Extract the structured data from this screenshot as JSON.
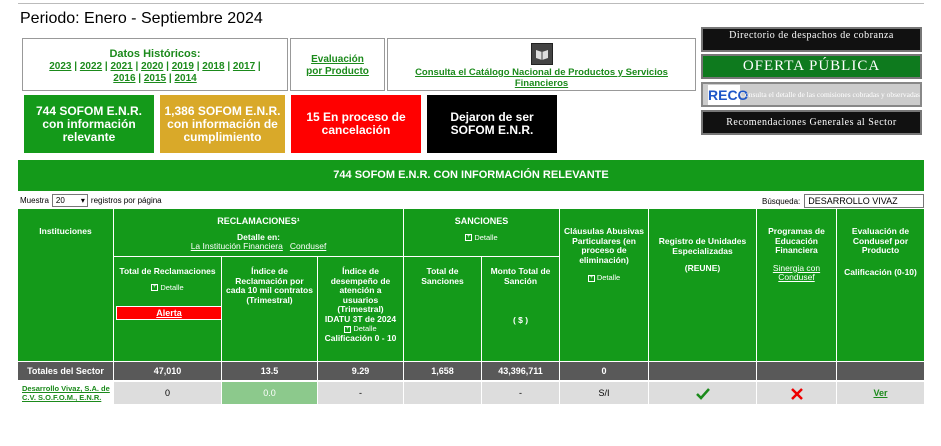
{
  "header": {
    "periodo": "Periodo: Enero - Septiembre 2024"
  },
  "historicos": {
    "title": "Datos Históricos:",
    "years": [
      "2023",
      "2022",
      "2021",
      "2020",
      "2019",
      "2018",
      "2017",
      "2016",
      "2015",
      "2014"
    ]
  },
  "evaluacion": {
    "line1": "Evaluación",
    "line2": "por Producto"
  },
  "catalogo": {
    "label": "Consulta el Catálogo Nacional de Productos y Servicios Financieros"
  },
  "right_links": {
    "directorio": "Directorio de despachos de cobranza",
    "oferta": "OFERTA PÚBLICA",
    "reco_logo": "RECO",
    "reco_text": "Consulta el detalle de las comisiones cobradas y observadas",
    "recomendaciones": "Recomendaciones Generales al Sector"
  },
  "kpis": [
    {
      "label": "744 SOFOM E.N.R. con información relevante",
      "color": "#149a1a"
    },
    {
      "label": "1,386 SOFOM E.N.R. con información de cumplimiento",
      "color": "#d9a929"
    },
    {
      "label": "15 En proceso de cancelación",
      "color": "#ff0000"
    },
    {
      "label": "Dejaron de ser SOFOM E.N.R.",
      "color": "#000000"
    }
  ],
  "banner": "744 SOFOM E.N.R. CON INFORMACIÓN RELEVANTE",
  "table_controls": {
    "muestra": "Muestra",
    "page_size": "20",
    "registros": "registros por página",
    "busqueda_label": "Búsqueda:",
    "busqueda_value": "DESARROLLO VIVAZ"
  },
  "headers": {
    "instituciones": "Instituciones",
    "reclamaciones": "RECLAMACIONES¹",
    "detalle_en": "Detalle en:",
    "inst_fin": "La Institución Financiera",
    "condusef": "Condusef",
    "sanciones": "SANCIONES",
    "detalle": "Detalle",
    "clausulas": "Cláusulas Abusivas Particulares (en proceso de eliminación)",
    "registro": "Registro de Unidades Especializadas",
    "reune": "(REUNE)",
    "programas": "Programas de Educación Financiera",
    "sinergia": "Sinergia con Condusef",
    "evaluacion": "Evaluación de Condusef por Producto",
    "calificacion": "Calificación (0-10)",
    "total_recl": "Total de Reclamaciones",
    "alerta": "Alerta",
    "indice_recl": "Índice de Reclamación por cada 10 mil contratos (Trimestral)",
    "indice_desemp": "Índice de desempeño de atención a usuarios (Trimestral)",
    "idatu": "IDATU 3T de 2024",
    "calif_range": "Calificación 0 - 10",
    "total_sanc": "Total de Sanciones",
    "monto_sanc": "Monto Total de Sanción",
    "pesos": "( $ )"
  },
  "totales": {
    "label": "Totales del Sector",
    "total_recl": "47,010",
    "indice_recl": "13.5",
    "indice_desemp": "9.29",
    "total_sanc": "1,658",
    "monto": "43,396,711",
    "clausulas": "0"
  },
  "rows": [
    {
      "institucion": "Desarrollo Vivaz, S.A. de C.V. S.O.F.O.M., E.N.R.",
      "total_recl": "0",
      "indice_recl": "0.0",
      "indice_desemp": "-",
      "total_sanc": "",
      "monto": "-",
      "clausulas": "S/I",
      "reune": "check-icon",
      "programas": "x-icon",
      "evaluacion": "Ver"
    }
  ]
}
